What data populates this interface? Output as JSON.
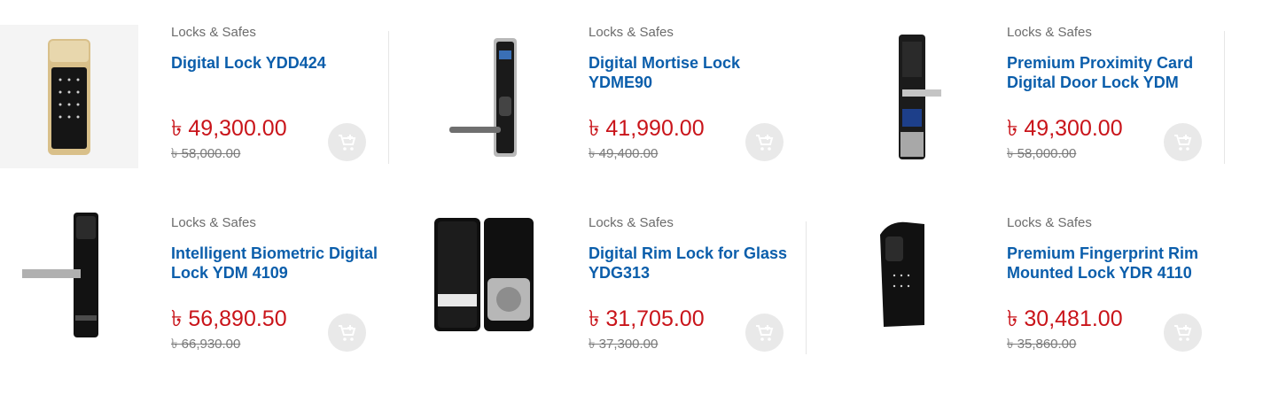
{
  "products": [
    {
      "category": "Locks & Safes",
      "title": "Digital Lock YDD424",
      "price": "৳ 49,300.00",
      "old_price": "৳ 58,000.00",
      "image": "digital-lock-ydd424-image"
    },
    {
      "category": "Locks & Safes",
      "title": "Digital Mortise Lock YDME90",
      "price": "৳ 41,990.00",
      "old_price": "৳ 49,400.00",
      "image": "digital-mortise-lock-image"
    },
    {
      "category": "Locks & Safes",
      "title": "Premium Proximity Card Digital Door Lock YDM",
      "price": "৳ 49,300.00",
      "old_price": "৳ 58,000.00",
      "image": "proximity-card-lock-image"
    },
    {
      "category": "Locks & Safes",
      "title": "Intelligent Biometric Digital Lock YDM 4109",
      "price": "৳ 56,890.50",
      "old_price": "৳ 66,930.00",
      "image": "biometric-lock-image"
    },
    {
      "category": "Locks & Safes",
      "title": "Digital Rim Lock for Glass YDG313",
      "price": "৳ 31,705.00",
      "old_price": "৳ 37,300.00",
      "image": "glass-rim-lock-image"
    },
    {
      "category": "Locks & Safes",
      "title": "Premium Fingerprint Rim Mounted Lock YDR 4110",
      "price": "৳ 30,481.00",
      "old_price": "৳ 35,860.00",
      "image": "fingerprint-rim-lock-image"
    }
  ],
  "cart_icon": "add-to-cart-icon",
  "colors": {
    "title": "#0b5eab",
    "price": "#c9141a",
    "old_price": "#7b7b7b",
    "category": "#6c6c6c",
    "cart_bg": "#e9e9e9"
  }
}
